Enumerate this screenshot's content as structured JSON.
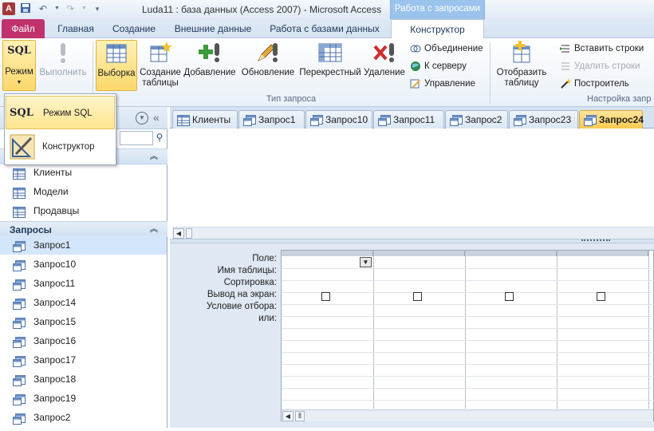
{
  "window": {
    "app_icon": "A",
    "title": "Luda11 : база данных (Access 2007)  -  Microsoft Access",
    "context_title": "Работа с запросами"
  },
  "quick_access": {
    "icons": [
      "save-icon",
      "undo-icon",
      "redo-icon",
      "customize-icon"
    ]
  },
  "tabs": {
    "file": "Файл",
    "home": "Главная",
    "create": "Создание",
    "external": "Внешние данные",
    "dbtools": "Работа с базами данных",
    "design": "Конструктор"
  },
  "ribbon": {
    "view": "Режим",
    "run": "Выполнить",
    "select": "Выборка",
    "make_table_1": "Создание",
    "make_table_2": "таблицы",
    "append": "Добавление",
    "update": "Обновление",
    "crosstab": "Перекрестный",
    "delete": "Удаление",
    "union": "Объединение",
    "pass_through": "К серверу",
    "data_definition": "Управление",
    "group_query_type": "Тип запроса",
    "show_table_1": "Отобразить",
    "show_table_2": "таблицу",
    "insert_rows": "Вставить строки",
    "delete_rows": "Удалить строки",
    "builder": "Построитель",
    "group_setup": "Настройка запр"
  },
  "view_menu": {
    "sql_prefix": "SQL",
    "sql_label": "Режим SQL",
    "design_label": "Конструктор"
  },
  "nav": {
    "tables": [
      "Клиенты",
      "Модели",
      "Продавцы"
    ],
    "queries_header": "Запросы",
    "queries": [
      "Запрос1",
      "Запрос10",
      "Запрос11",
      "Запрос14",
      "Запрос15",
      "Запрос16",
      "Запрос17",
      "Запрос18",
      "Запрос19",
      "Запрос2"
    ]
  },
  "doc_tabs": [
    "Клиенты",
    "Запрос1",
    "Запрос10",
    "Запрос11",
    "Запрос2",
    "Запрос23",
    "Запрос24"
  ],
  "qbe": {
    "rows": [
      "Поле:",
      "Имя таблицы:",
      "Сортировка:",
      "Вывод на экран:",
      "Условие отбора:",
      "или:"
    ]
  },
  "colors": {
    "file_tab": "#c0326c",
    "context": "#9ac3ed",
    "active_tab": "#fbc94f"
  }
}
